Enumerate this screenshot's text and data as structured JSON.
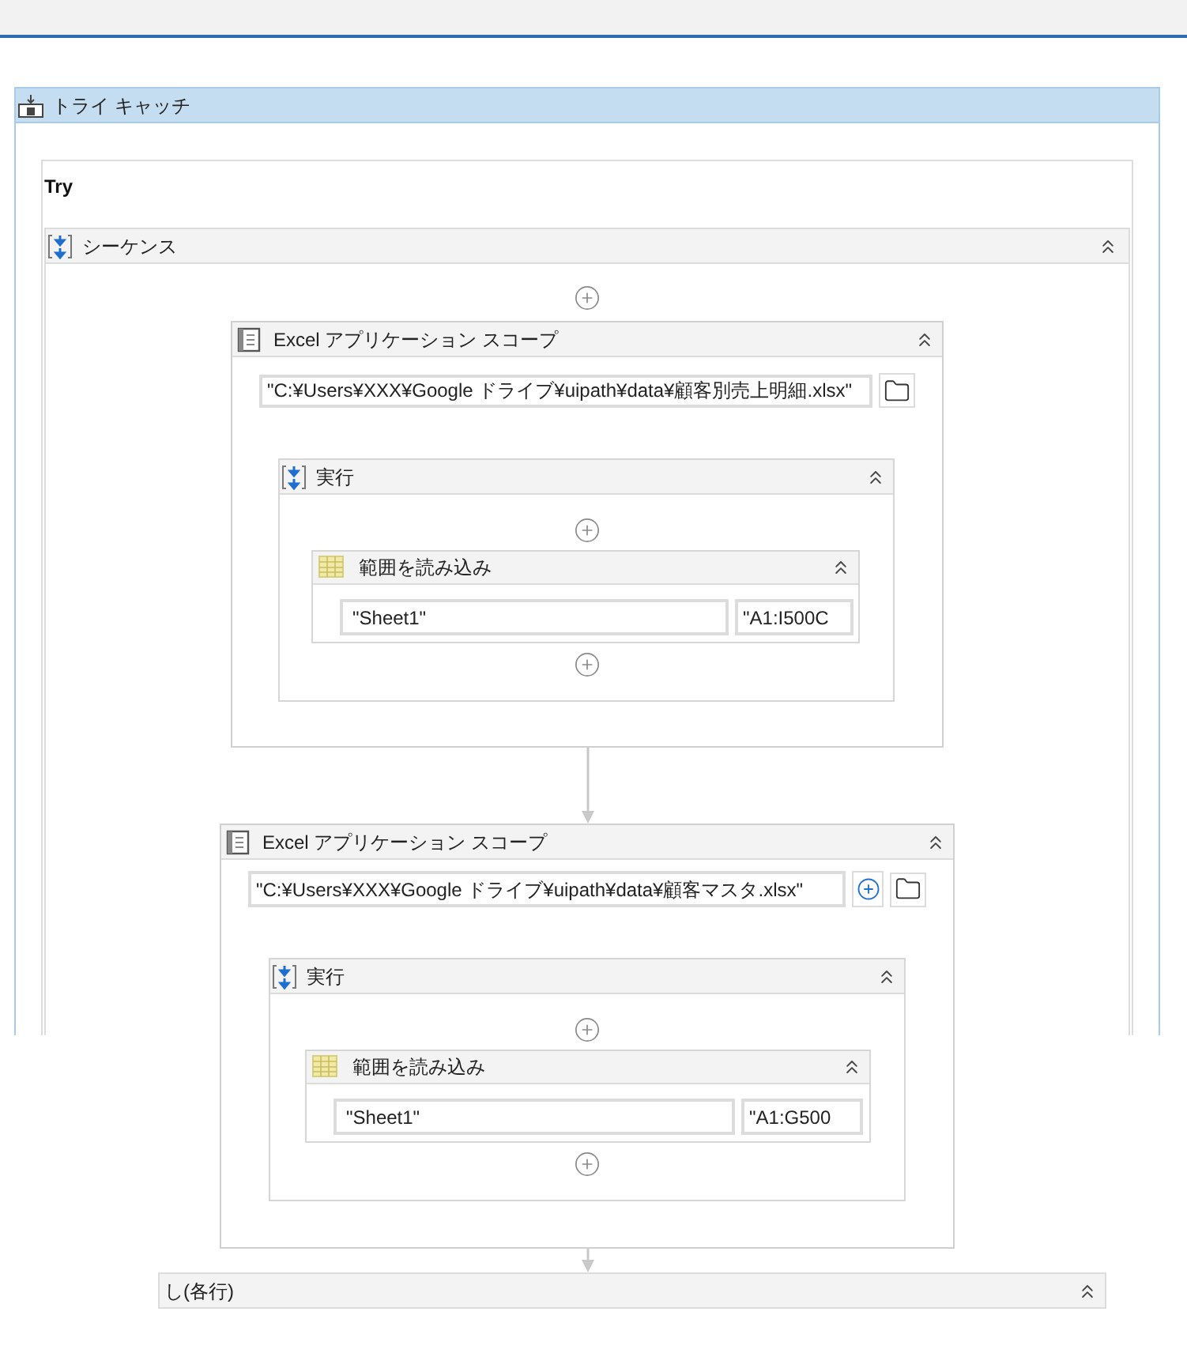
{
  "try_catch": {
    "title": "トライ キャッチ",
    "try_label": "Try",
    "sequence": {
      "title": "シーケンス",
      "expanded": true,
      "activities": [
        {
          "kind": "excel_scope",
          "title": "Excel アプリケーション スコープ",
          "expanded": true,
          "path": "\"C:¥Users¥XXX¥Google ドライブ¥uipath¥data¥顧客別売上明細.xlsx\"",
          "path_add_button": false,
          "body": {
            "title": "実行",
            "expanded": true,
            "activities": [
              {
                "kind": "read_range",
                "title": "範囲を読み込み",
                "expanded": true,
                "sheet": "\"Sheet1\"",
                "range": "\"A1:I500C"
              }
            ]
          }
        },
        {
          "kind": "excel_scope",
          "title": "Excel アプリケーション スコープ",
          "expanded": true,
          "path": "\"C:¥Users¥XXX¥Google ドライブ¥uipath¥data¥顧客マスタ.xlsx\"",
          "path_add_button": true,
          "body": {
            "title": "実行",
            "expanded": true,
            "activities": [
              {
                "kind": "read_range",
                "title": "範囲を読み込み",
                "expanded": true,
                "sheet": "\"Sheet1\"",
                "range": "\"A1:G500"
              }
            ]
          }
        },
        {
          "kind": "for_each",
          "title": "し(各行)",
          "expanded": true
        }
      ]
    }
  }
}
